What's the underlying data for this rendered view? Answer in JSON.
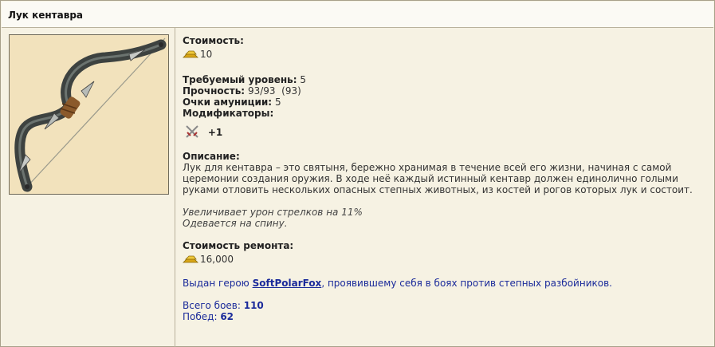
{
  "title": "Лук кентавра",
  "cost": {
    "label": "Стоимость:",
    "value": "10"
  },
  "req_level": {
    "label": "Требуемый уровень:",
    "value": "5"
  },
  "durability": {
    "label": "Прочность:",
    "value": "93/93  (93)"
  },
  "ammo_points": {
    "label": "Очки амуниции:",
    "value": "5"
  },
  "modifiers": {
    "label": "Модификаторы:",
    "value": "+1",
    "icon": "crossed-swords-icon"
  },
  "description": {
    "label": "Описание:",
    "lines": [
      "Лук для кентавра – это святыня, бережно хранимая в течение всей его жизни, начиная с самой",
      "церемонии создания оружия. В ходе неё каждый истинный кентавр должен единолично голыми",
      "руками отловить нескольких опасных степных животных, из костей и рогов которых лук и состоит."
    ]
  },
  "effects": [
    "Увеличивает урон стрелков на 11%",
    "Одевается на спину."
  ],
  "repair": {
    "label": "Стоимость ремонта:",
    "value": "16,000"
  },
  "given": {
    "prefix": "Выдан герою ",
    "hero": "SoftPolarFox",
    "suffix": ", проявившему себя в боях против степных разбойников."
  },
  "stats": {
    "battles_label": "Всего боев: ",
    "battles": "110",
    "wins_label": "Побед: ",
    "wins": "62"
  },
  "colors": {
    "link": "#1a2a9a",
    "panel": "#f6f2e3",
    "image_bg": "#f2e2bc"
  }
}
